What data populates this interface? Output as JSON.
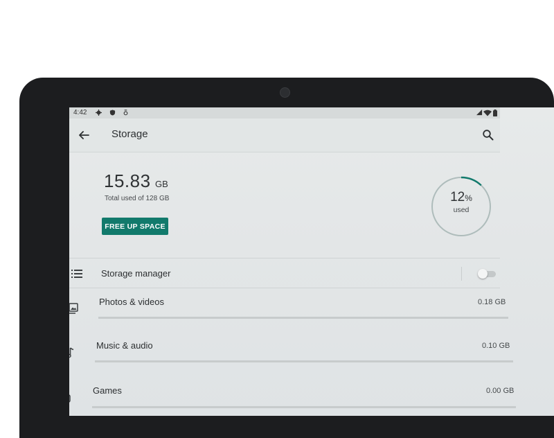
{
  "status": {
    "time": "4:42"
  },
  "header": {
    "title": "Storage"
  },
  "summary": {
    "used_value": "15.83",
    "used_unit": "GB",
    "total_label": "Total used of 128 GB",
    "free_up_label": "FREE UP SPACE",
    "percent": "12",
    "percent_sign": "%",
    "percent_label": "used",
    "percent_fraction": 0.12
  },
  "storage_manager": {
    "label": "Storage manager",
    "enabled": false
  },
  "categories": [
    {
      "label": "Photos & videos",
      "size": "0.18 GB",
      "icon": "photos-icon",
      "fraction": 0.0
    },
    {
      "label": "Music & audio",
      "size": "0.10 GB",
      "icon": "music-note-icon",
      "fraction": 0.0
    },
    {
      "label": "Games",
      "size": "0.00 GB",
      "icon": "gamepad-icon",
      "fraction": 0.0
    }
  ],
  "colors": {
    "accent": "#127a6c",
    "ring_track": "#aebcbb"
  }
}
